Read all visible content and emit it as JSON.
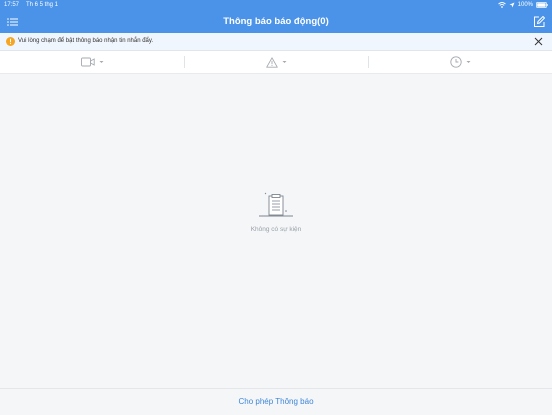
{
  "status_bar": {
    "time": "17:57",
    "date": "Th 6 5 thg 1",
    "battery": "100%"
  },
  "header": {
    "title": "Thông báo báo động(0)",
    "left_icon": "menu-icon",
    "right_icon": "edit-icon"
  },
  "notice": {
    "text": "Vui lòng chạm để bật thông báo nhận tin nhắn đẩy.",
    "icon": "warning-circle-icon",
    "close_icon": "close-icon"
  },
  "filters": [
    {
      "icon": "camera-icon"
    },
    {
      "icon": "alert-triangle-icon"
    },
    {
      "icon": "clock-icon"
    }
  ],
  "empty_state": {
    "text": "Không có sự kiện",
    "icon": "empty-document-icon"
  },
  "bottom": {
    "link_label": "Cho phép Thông báo"
  },
  "colors": {
    "header_bg": "#4a93e8",
    "notice_bg": "#f0f6fd",
    "warning": "#f5a623",
    "link": "#3d86d8",
    "page_bg": "#f5f6f8"
  }
}
